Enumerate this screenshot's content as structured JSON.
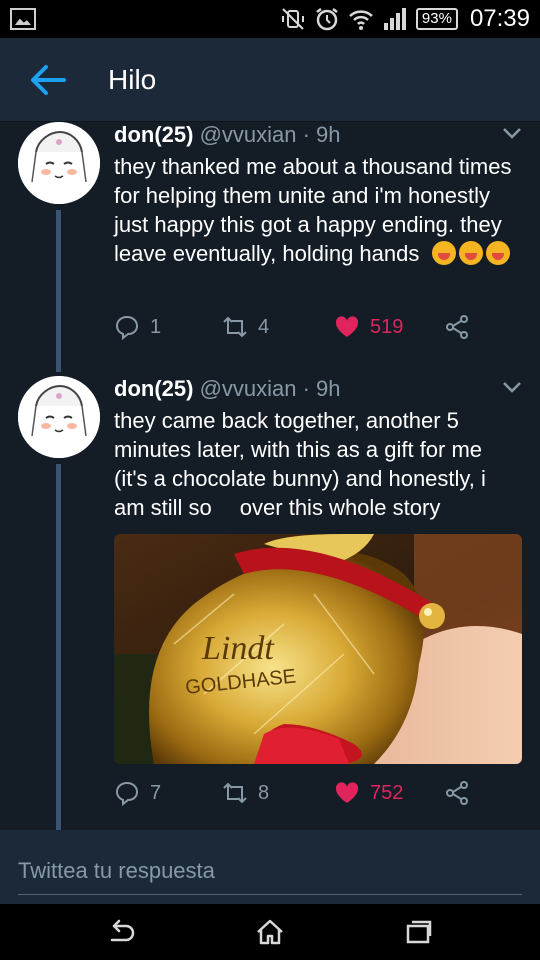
{
  "status_bar": {
    "battery": "93%",
    "time": "07:39",
    "icons": [
      "gallery-icon",
      "vibrate-off-icon",
      "alarm-icon",
      "wifi-icon",
      "signal-icon",
      "battery-icon"
    ]
  },
  "header": {
    "back_icon": "arrow-left-icon",
    "title": "Hilo"
  },
  "tweets": [
    {
      "name": "don(25)",
      "handle": "@vvuxian · 9h",
      "text": "they thanked me about a thousand times for helping them unite and i'm honestly just happy this got a happy ending. they leave eventually, holding hands",
      "emojis": [
        "face-emoji",
        "face-emoji",
        "face-emoji"
      ],
      "replies": "1",
      "retweets": "4",
      "likes": "519"
    },
    {
      "name": "don(25)",
      "handle": "@vvuxian · 9h",
      "text_a": "they came back together, another 5 minutes later, with this as a gift for me (it's a chocolate bunny) and honestly, i am still so",
      "text_b": "over this whole story",
      "photo_labels": {
        "brand": "Lindt",
        "product": "GOLDHASE"
      },
      "replies": "7",
      "retweets": "8",
      "likes": "752"
    }
  ],
  "reply_bar": {
    "placeholder": "Twittea tu respuesta"
  },
  "colors": {
    "background": "#141d26",
    "header": "#1c2938",
    "accent": "#1da1f2",
    "like": "#e0245e",
    "muted": "#8899a6"
  }
}
